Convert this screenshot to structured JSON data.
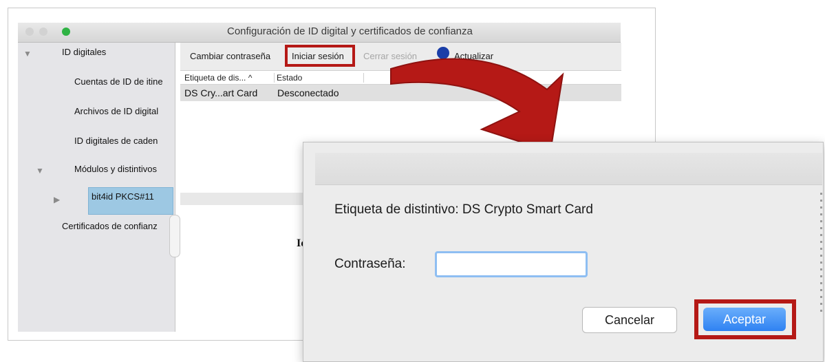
{
  "window": {
    "title": "Configuración de ID digital y certificados de confianza",
    "traffic_lights": [
      "#d0d0d0",
      "#d0d0d0",
      "#2fb344"
    ]
  },
  "sidebar": {
    "items": [
      {
        "label": "ID digitales",
        "expanded": true
      },
      {
        "label": "Cuentas de ID de itine"
      },
      {
        "label": "Archivos de ID digital"
      },
      {
        "label": "ID digitales de caden"
      },
      {
        "label": "Módulos y distintivos",
        "expanded": true
      },
      {
        "label": "bit4id PKCS#11",
        "selected": true,
        "expanded": false
      },
      {
        "label": "Certificados de confianz"
      }
    ]
  },
  "toolbar": {
    "change_password": "Cambiar contraseña",
    "login": "Iniciar sesión",
    "logout": "Cerrar sesión",
    "update": "Actualizar"
  },
  "table": {
    "columns": [
      "Etiqueta de dis... ^",
      "Estado"
    ],
    "rows": [
      [
        "DS Cry...art Card",
        "Desconectado"
      ]
    ]
  },
  "partial_text": "Id",
  "dialog": {
    "label_text": "Etiqueta de distintivo: DS Crypto Smart Card",
    "password_label": "Contraseña:",
    "password_value": "",
    "cancel": "Cancelar",
    "accept": "Aceptar"
  },
  "colors": {
    "highlight": "#b51916",
    "selection": "#9dc8e3",
    "accept_button": "#2f82f2",
    "arrow": "#b51916"
  }
}
